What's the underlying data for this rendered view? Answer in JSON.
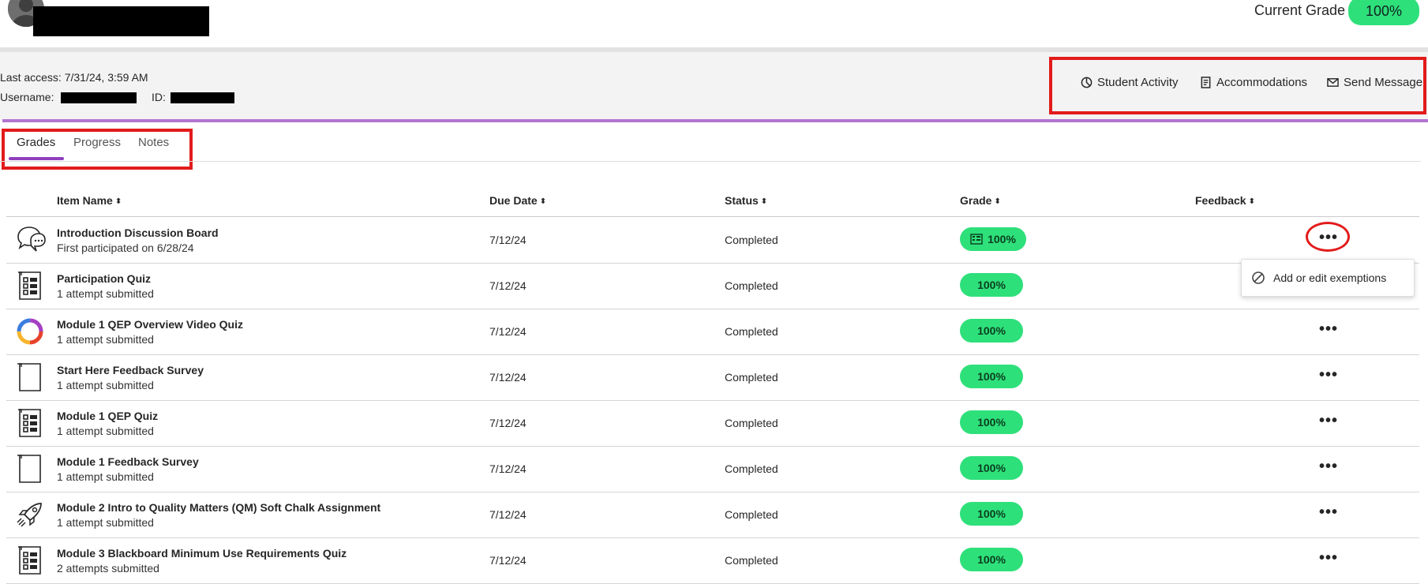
{
  "header": {
    "current_grade_label": "Current Grade",
    "current_grade_value": "100%"
  },
  "meta": {
    "last_access_label": "Last access:",
    "last_access_value": "7/31/24, 3:59 AM",
    "username_label": "Username:",
    "id_label": "ID:"
  },
  "actions": {
    "student_activity": "Student Activity",
    "accommodations": "Accommodations",
    "send_message": "Send Message"
  },
  "tabs": [
    {
      "label": "Grades",
      "active": true
    },
    {
      "label": "Progress",
      "active": false
    },
    {
      "label": "Notes",
      "active": false
    }
  ],
  "columns": {
    "item_name": "Item Name",
    "due_date": "Due Date",
    "status": "Status",
    "grade": "Grade",
    "feedback": "Feedback"
  },
  "rows": [
    {
      "icon": "discussion-icon",
      "title": "Introduction Discussion Board",
      "sub": "First participated on 6/28/24",
      "due": "7/12/24",
      "status": "Completed",
      "grade": "100%"
    },
    {
      "icon": "test-icon",
      "title": "Participation Quiz",
      "sub": "1 attempt submitted",
      "due": "7/12/24",
      "status": "Completed",
      "grade": "100%"
    },
    {
      "icon": "video-quiz-logo-icon",
      "title": "Module 1 QEP Overview Video Quiz",
      "sub": "1 attempt submitted",
      "due": "7/12/24",
      "status": "Completed",
      "grade": "100%"
    },
    {
      "icon": "document-icon",
      "title": "Start Here Feedback Survey",
      "sub": "1 attempt submitted",
      "due": "7/12/24",
      "status": "Completed",
      "grade": "100%"
    },
    {
      "icon": "test-icon",
      "title": "Module 1 QEP Quiz",
      "sub": "1 attempt submitted",
      "due": "7/12/24",
      "status": "Completed",
      "grade": "100%"
    },
    {
      "icon": "document-icon",
      "title": "Module 1 Feedback Survey",
      "sub": "1 attempt submitted",
      "due": "7/12/24",
      "status": "Completed",
      "grade": "100%"
    },
    {
      "icon": "rocket-icon",
      "title": "Module 2 Intro to Quality Matters (QM) Soft Chalk Assignment",
      "sub": "1 attempt submitted",
      "due": "7/12/24",
      "status": "Completed",
      "grade": "100%"
    },
    {
      "icon": "test-icon",
      "title": "Module 3 Blackboard Minimum Use Requirements Quiz",
      "sub": "2 attempts submitted",
      "due": "7/12/24",
      "status": "Completed",
      "grade": "100%"
    }
  ],
  "menu": {
    "add_exemptions": "Add or edit exemptions"
  },
  "colors": {
    "grade_pill": "#2ee07a",
    "tab_accent": "#8f3fbf",
    "highlight": "#e21b1b"
  }
}
